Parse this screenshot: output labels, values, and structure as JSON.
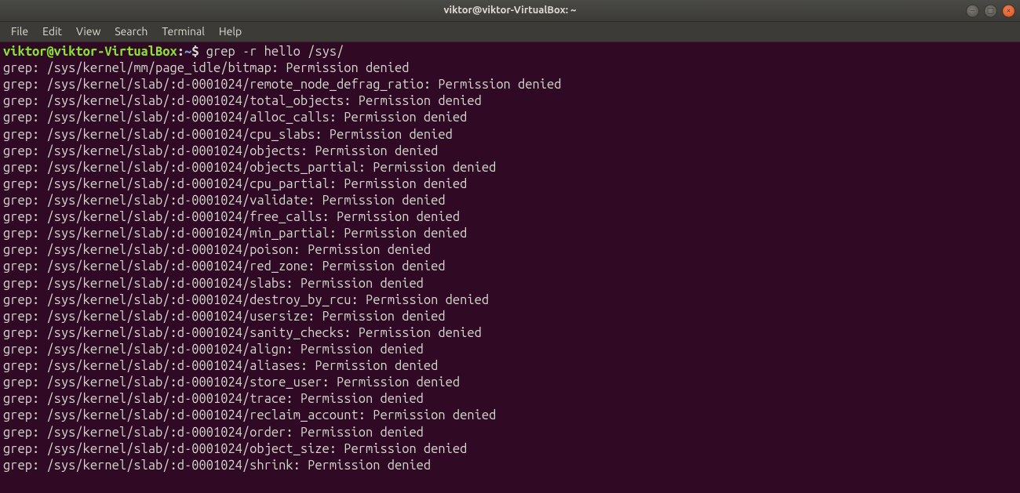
{
  "window": {
    "title": "viktor@viktor-VirtualBox: ~",
    "controls": {
      "minimize": "–",
      "maximize": "▢",
      "close": "×"
    }
  },
  "menubar": {
    "items": [
      "File",
      "Edit",
      "View",
      "Search",
      "Terminal",
      "Help"
    ]
  },
  "prompt": {
    "user_host": "viktor@viktor-VirtualBox",
    "colon": ":",
    "path": "~",
    "symbol": "$ "
  },
  "command": "grep -r hello /sys/",
  "output_lines": [
    "grep: /sys/kernel/mm/page_idle/bitmap: Permission denied",
    "grep: /sys/kernel/slab/:d-0001024/remote_node_defrag_ratio: Permission denied",
    "grep: /sys/kernel/slab/:d-0001024/total_objects: Permission denied",
    "grep: /sys/kernel/slab/:d-0001024/alloc_calls: Permission denied",
    "grep: /sys/kernel/slab/:d-0001024/cpu_slabs: Permission denied",
    "grep: /sys/kernel/slab/:d-0001024/objects: Permission denied",
    "grep: /sys/kernel/slab/:d-0001024/objects_partial: Permission denied",
    "grep: /sys/kernel/slab/:d-0001024/cpu_partial: Permission denied",
    "grep: /sys/kernel/slab/:d-0001024/validate: Permission denied",
    "grep: /sys/kernel/slab/:d-0001024/free_calls: Permission denied",
    "grep: /sys/kernel/slab/:d-0001024/min_partial: Permission denied",
    "grep: /sys/kernel/slab/:d-0001024/poison: Permission denied",
    "grep: /sys/kernel/slab/:d-0001024/red_zone: Permission denied",
    "grep: /sys/kernel/slab/:d-0001024/slabs: Permission denied",
    "grep: /sys/kernel/slab/:d-0001024/destroy_by_rcu: Permission denied",
    "grep: /sys/kernel/slab/:d-0001024/usersize: Permission denied",
    "grep: /sys/kernel/slab/:d-0001024/sanity_checks: Permission denied",
    "grep: /sys/kernel/slab/:d-0001024/align: Permission denied",
    "grep: /sys/kernel/slab/:d-0001024/aliases: Permission denied",
    "grep: /sys/kernel/slab/:d-0001024/store_user: Permission denied",
    "grep: /sys/kernel/slab/:d-0001024/trace: Permission denied",
    "grep: /sys/kernel/slab/:d-0001024/reclaim_account: Permission denied",
    "grep: /sys/kernel/slab/:d-0001024/order: Permission denied",
    "grep: /sys/kernel/slab/:d-0001024/object_size: Permission denied",
    "grep: /sys/kernel/slab/:d-0001024/shrink: Permission denied"
  ]
}
